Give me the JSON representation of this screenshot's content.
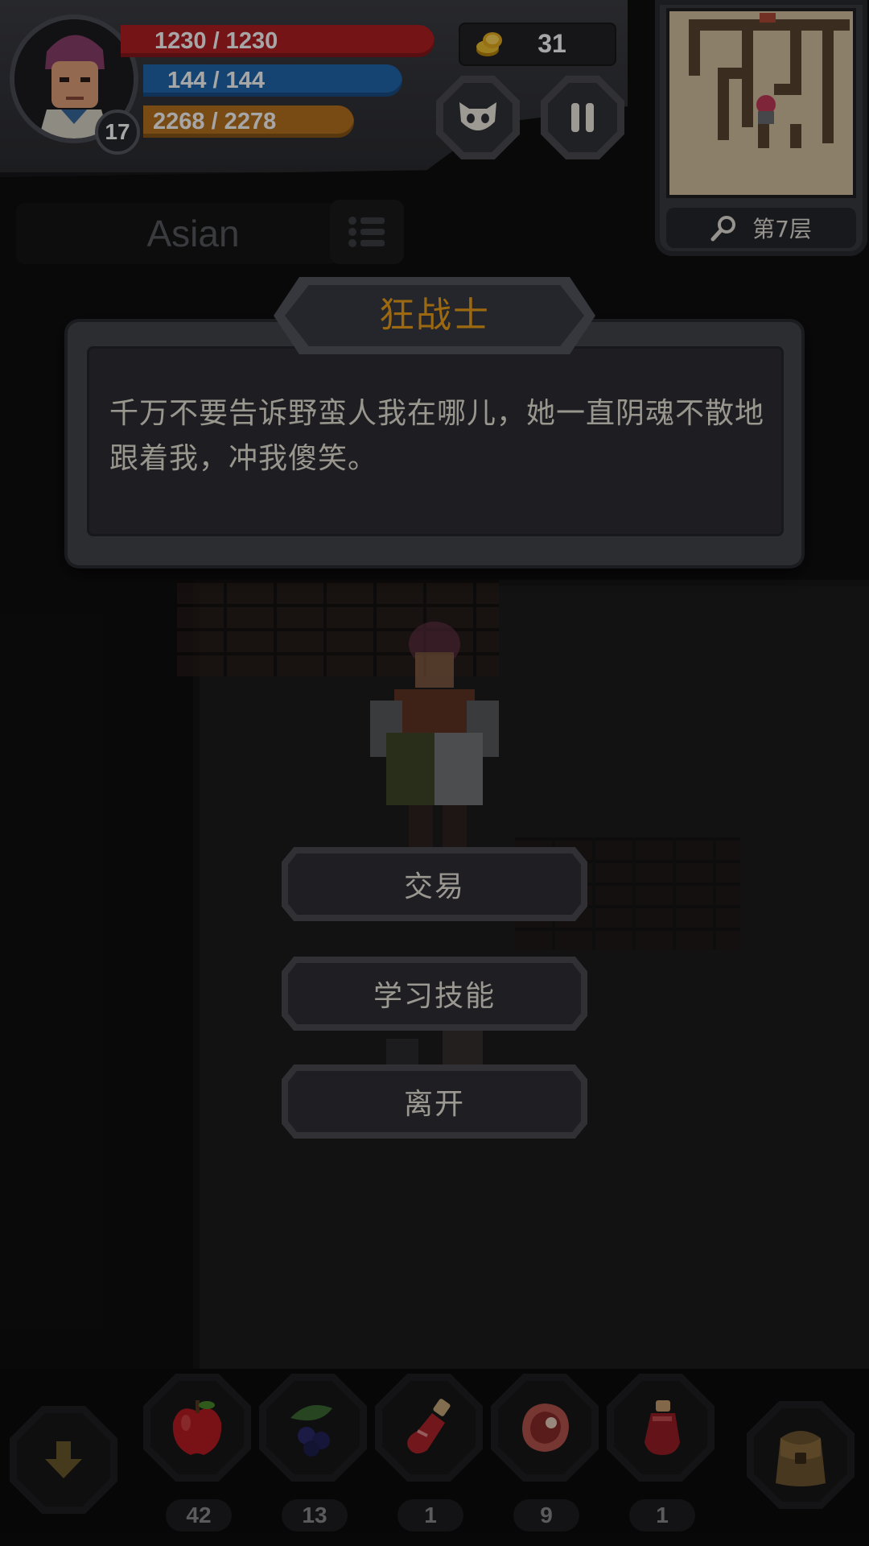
{
  "player": {
    "level": "17",
    "hp": "1230 / 1230",
    "mp": "144 / 144",
    "exp": "2268 / 2278",
    "name": "Asian"
  },
  "currency": {
    "gold": "31"
  },
  "minimap": {
    "floor": "第7层"
  },
  "dialog": {
    "npc_title": "狂战士",
    "text": "千万不要告诉野蛮人我在哪儿，她一直阴魂不散地跟着我，冲我傻笑。",
    "options": [
      "交易",
      "学习技能",
      "离开"
    ]
  },
  "quickbar": {
    "items": [
      {
        "icon": "apple-icon",
        "count": "42"
      },
      {
        "icon": "berries-icon",
        "count": "13"
      },
      {
        "icon": "potion-icon",
        "count": "1"
      },
      {
        "icon": "meat-icon",
        "count": "9"
      },
      {
        "icon": "red-potion-icon",
        "count": "1"
      }
    ]
  },
  "colors": {
    "hp": "#b41f24",
    "mp": "#2369b0",
    "exp": "#b8741f",
    "title": "#f0a21a"
  }
}
